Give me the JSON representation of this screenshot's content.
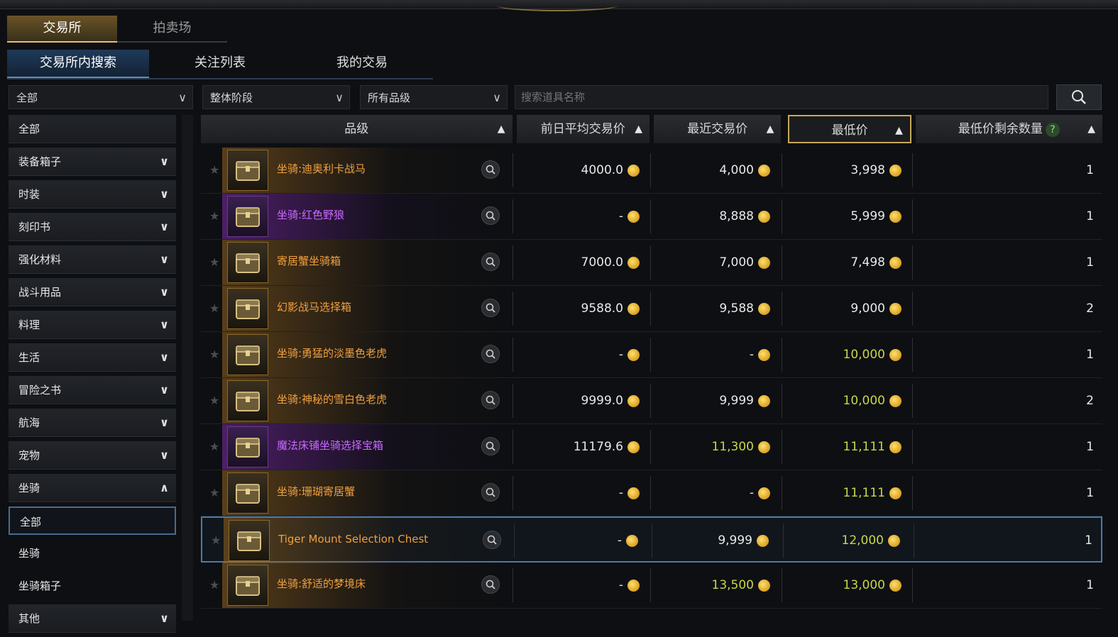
{
  "main_tabs": [
    "交易所",
    "拍卖场"
  ],
  "sub_tabs": [
    "交易所内搜索",
    "关注列表",
    "我的交易"
  ],
  "filters": {
    "category": "全部",
    "stage": "整体阶段",
    "grade": "所有品级",
    "search_placeholder": "搜索道具名称"
  },
  "sidebar": {
    "items": [
      {
        "label": "全部"
      },
      {
        "label": "装备箱子"
      },
      {
        "label": "时装"
      },
      {
        "label": "刻印书"
      },
      {
        "label": "强化材料"
      },
      {
        "label": "战斗用品"
      },
      {
        "label": "料理"
      },
      {
        "label": "生活"
      },
      {
        "label": "冒险之书"
      },
      {
        "label": "航海"
      },
      {
        "label": "宠物"
      },
      {
        "label": "坐骑"
      },
      {
        "label": "全部"
      },
      {
        "label": "坐骑"
      },
      {
        "label": "坐骑箱子"
      },
      {
        "label": "其他"
      }
    ]
  },
  "table": {
    "headers": [
      "品级",
      "前日平均交易价",
      "最近交易价",
      "最低价",
      "最低价剩余数量"
    ],
    "help": "?",
    "rows": [
      {
        "name": "坐骑:迪奥利卡战马",
        "avg": "4000.0",
        "recent": "4,000",
        "lowest": "3,998",
        "qty": "1",
        "rarity": "legendary"
      },
      {
        "name": "坐骑:红色野狼",
        "avg": "-",
        "recent": "8,888",
        "lowest": "5,999",
        "qty": "1",
        "rarity": "epic"
      },
      {
        "name": "寄居蟹坐骑箱",
        "avg": "7000.0",
        "recent": "7,000",
        "lowest": "7,498",
        "qty": "1",
        "rarity": "legendary"
      },
      {
        "name": "幻影战马选择箱",
        "avg": "9588.0",
        "recent": "9,588",
        "lowest": "9,000",
        "qty": "2",
        "rarity": "legendary"
      },
      {
        "name": "坐骑:勇猛的淡墨色老虎",
        "avg": "-",
        "recent": "-",
        "lowest": "10,000",
        "qty": "1",
        "rarity": "legendary"
      },
      {
        "name": "坐骑:神秘的雪白色老虎",
        "avg": "9999.0",
        "recent": "9,999",
        "lowest": "10,000",
        "qty": "2",
        "rarity": "legendary"
      },
      {
        "name": "魔法床铺坐骑选择宝箱",
        "avg": "11179.6",
        "recent": "11,300",
        "lowest": "11,111",
        "qty": "1",
        "rarity": "epic"
      },
      {
        "name": "坐骑:珊瑚寄居蟹",
        "avg": "-",
        "recent": "-",
        "lowest": "11,111",
        "qty": "1",
        "rarity": "legendary"
      },
      {
        "name": "Tiger Mount Selection Chest",
        "avg": "-",
        "recent": "9,999",
        "lowest": "12,000",
        "qty": "1",
        "rarity": "legendary"
      },
      {
        "name": "坐骑:舒适的梦境床",
        "avg": "-",
        "recent": "13,500",
        "lowest": "13,000",
        "qty": "1",
        "rarity": "legendary"
      }
    ]
  },
  "colors": {
    "legendary": "#f0a040",
    "epic": "#c96aff",
    "accent": "#c9a85c",
    "selection": "#4f79a8",
    "price_highlight": "#c9d64a"
  }
}
